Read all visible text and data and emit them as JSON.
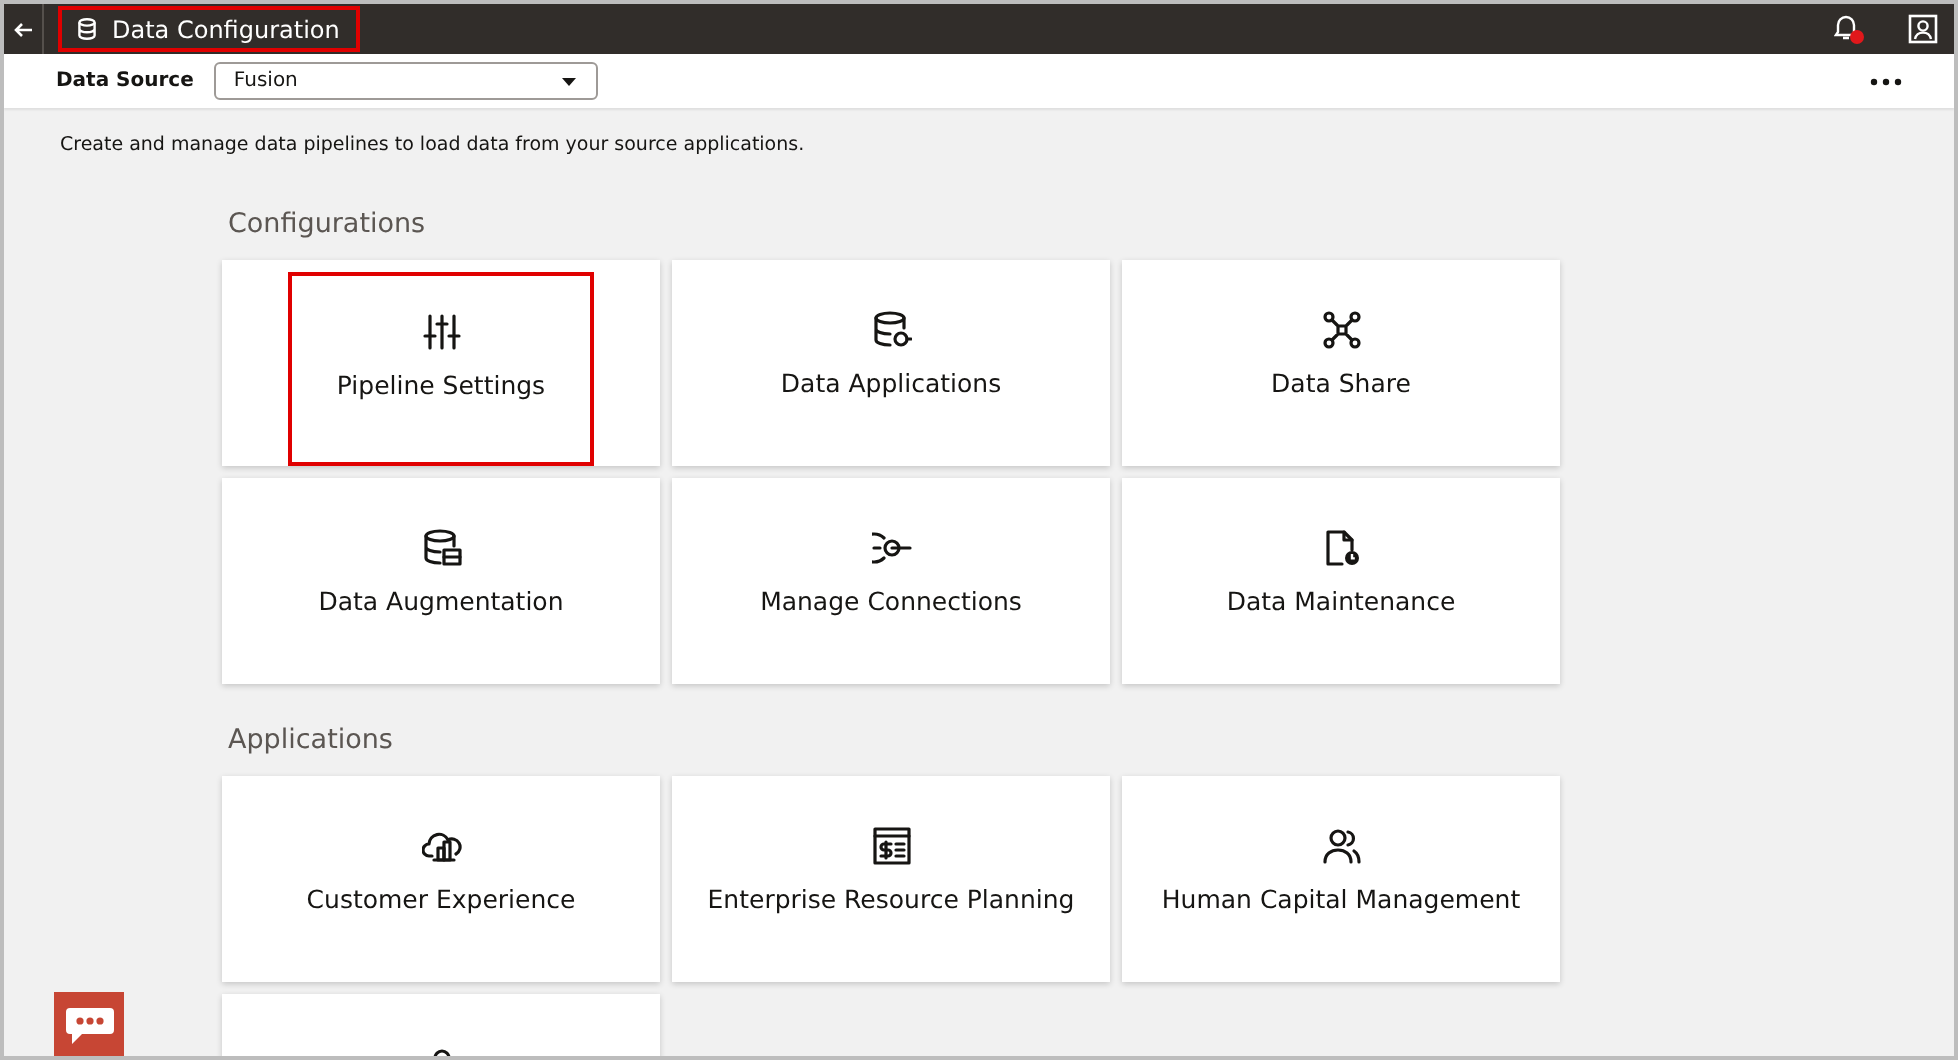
{
  "header": {
    "title": "Data Configuration",
    "title_highlighted": true
  },
  "toolbar": {
    "label": "Data Source",
    "dropdown_value": "Fusion"
  },
  "description": "Create and manage data pipelines to load data from your source applications.",
  "sections": [
    {
      "heading": "Configurations",
      "tiles": [
        {
          "kind": "full",
          "label": "Pipeline Settings",
          "highlighted": true
        },
        {
          "kind": "full",
          "label": "Data Applications",
          "highlighted": false
        },
        {
          "kind": "full",
          "label": "Data Share",
          "highlighted": false
        },
        {
          "kind": "full",
          "label": "Data Augmentation",
          "highlighted": false
        },
        {
          "kind": "full",
          "label": "Manage Connections",
          "highlighted": false
        },
        {
          "kind": "full",
          "label": "Data Maintenance",
          "highlighted": false
        }
      ]
    },
    {
      "heading": "Applications",
      "tiles": [
        {
          "kind": "full",
          "label": "Customer Experience",
          "highlighted": false
        },
        {
          "kind": "full",
          "label": "Enterprise Resource Planning",
          "highlighted": false
        },
        {
          "kind": "full",
          "label": "Human Capital Management",
          "highlighted": false
        },
        {
          "kind": "partial",
          "highlighted": false
        }
      ]
    }
  ]
}
